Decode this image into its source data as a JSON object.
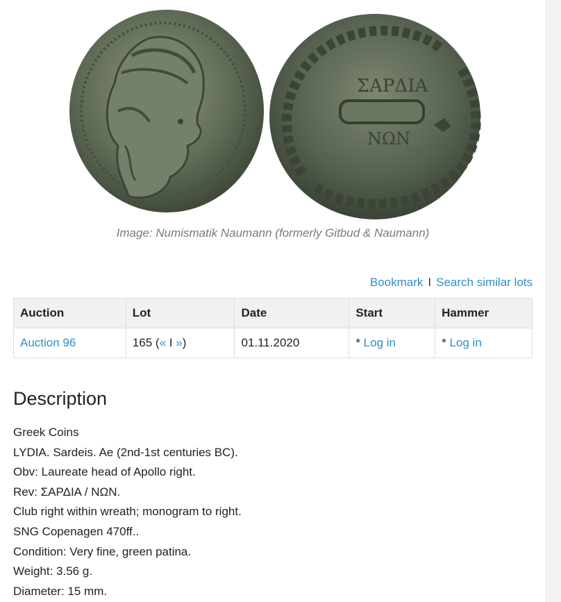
{
  "image": {
    "caption": "Image: Numismatik Naumann (formerly Gitbud & Naumann)",
    "reverse_legend_top": "ΣΑΡΔΙΑ",
    "reverse_legend_bottom": "ΝΩΝ",
    "colors": {
      "bronze_dark": "#3f4a38",
      "bronze_light": "#8a9478",
      "patina": "#6b7560"
    }
  },
  "actions": {
    "bookmark": "Bookmark",
    "separator": "I",
    "search_similar": "Search similar lots"
  },
  "table": {
    "headers": [
      "Auction",
      "Lot",
      "Date",
      "Start",
      "Hammer"
    ],
    "row": {
      "auction": "Auction 96",
      "lot_number": "165",
      "lot_nav_open": "(",
      "lot_prev": "«",
      "lot_sep": "I",
      "lot_next": "»",
      "lot_nav_close": ")",
      "date": "01.11.2020",
      "start_prefix": "* ",
      "start_link": "Log in",
      "hammer_prefix": "* ",
      "hammer_link": "Log in"
    }
  },
  "description": {
    "heading": "Description",
    "lines": [
      "Greek Coins",
      "LYDIA. Sardeis. Ae (2nd-1st centuries BC).",
      "Obv: Laureate head of Apollo right.",
      "Rev: ΣΑΡΔΙΑ / ΝΩΝ.",
      "Club right within wreath; monogram to right.",
      "SNG Copenagen 470ff..",
      "Condition: Very fine, green patina.",
      "Weight: 3.56 g.",
      "Diameter: 15 mm."
    ]
  },
  "links_color": "#2f8fc6"
}
